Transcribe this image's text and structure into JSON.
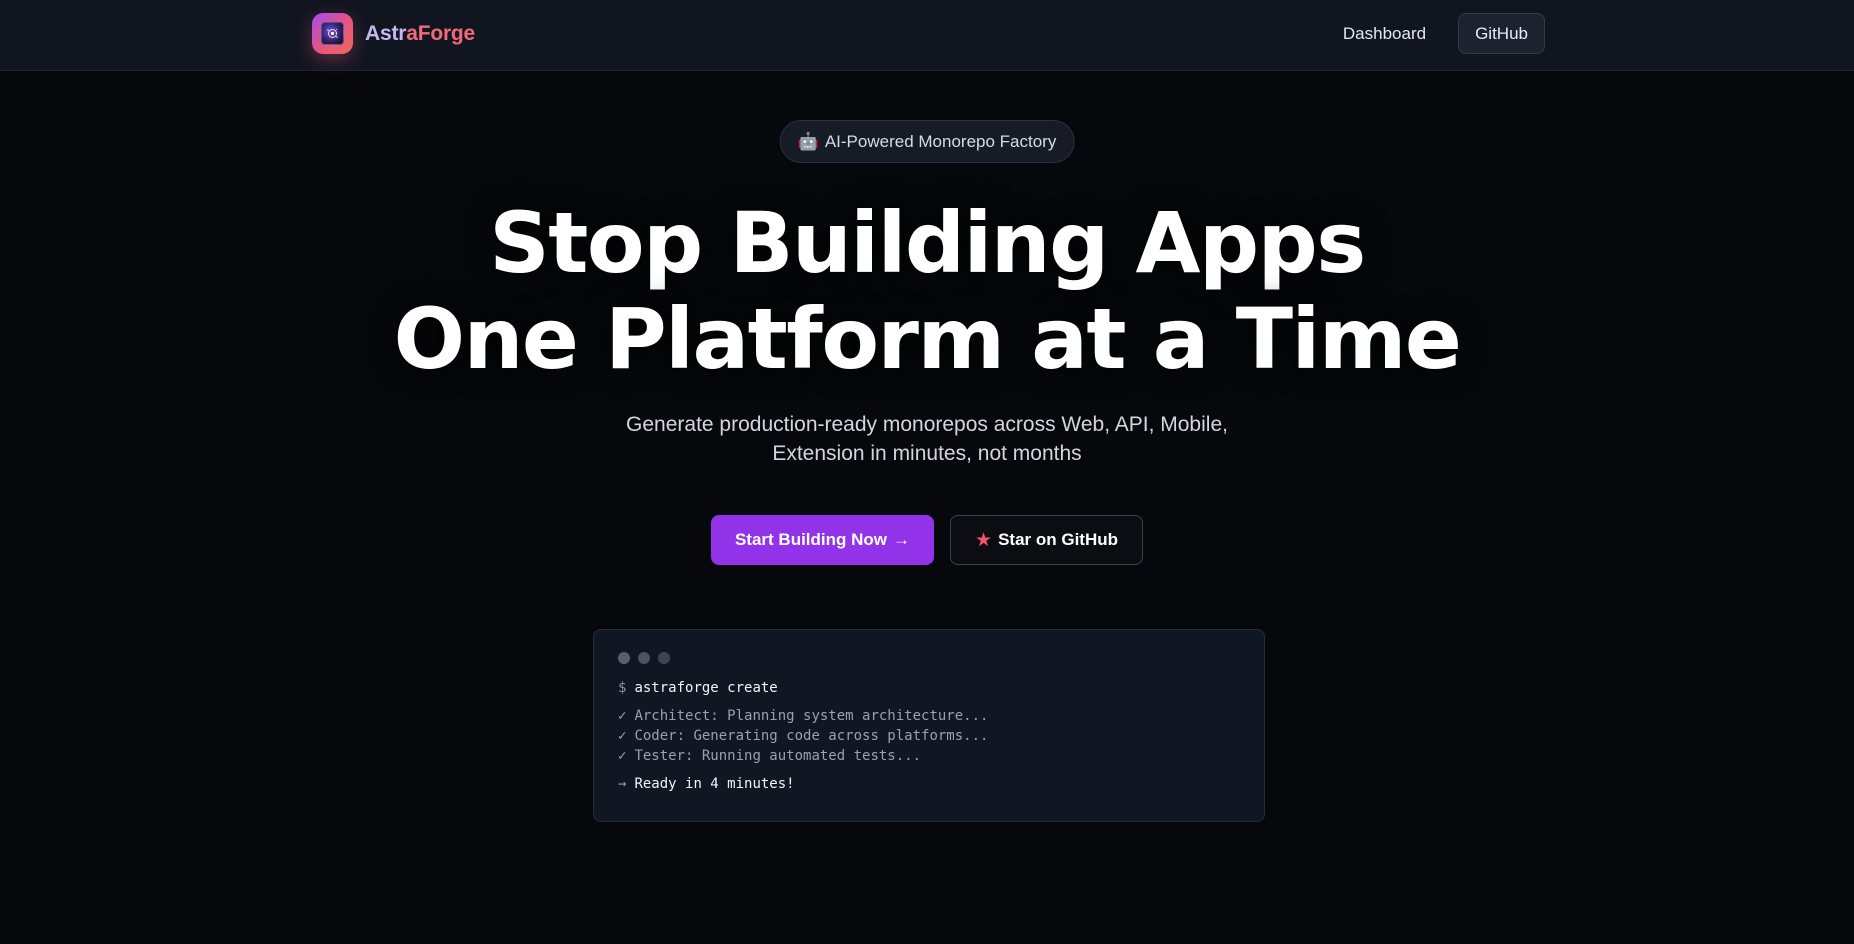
{
  "header": {
    "brand_part1": "Astr",
    "brand_part2": "aForge",
    "nav": {
      "dashboard": "Dashboard",
      "github": "GitHub"
    }
  },
  "hero": {
    "badge_icon": "🤖",
    "badge_text": "AI-Powered Monorepo Factory",
    "headline_line1": "Stop Building Apps",
    "headline_line2": "One Platform at a Time",
    "subhead_line1": "Generate production-ready monorepos across Web, API, Mobile,",
    "subhead_line2": "Extension in minutes, not months",
    "cta_primary": "Start Building Now",
    "cta_primary_arrow": "→",
    "cta_secondary_icon": "★",
    "cta_secondary": "Star on GitHub"
  },
  "terminal": {
    "prompt": "$",
    "command": "astraforge create",
    "check_glyph": "✓",
    "logs": [
      "Architect: Planning system architecture...",
      "Coder: Generating code across platforms...",
      "Tester: Running automated tests..."
    ],
    "ready_arrow": "→",
    "ready_text": "Ready in 4 minutes!"
  },
  "icons": {
    "logo": "rocket-galaxy-logo-icon",
    "badge": "robot-icon",
    "star": "star-icon",
    "window_dots": "window-control-dots"
  },
  "colors": {
    "accent_purple": "#9233ea",
    "brand_pink": "#f26a7a",
    "brand_lavender": "#c7b8f0",
    "background": "#07080c",
    "header_bg": "#111520",
    "terminal_bg": "#111623"
  }
}
